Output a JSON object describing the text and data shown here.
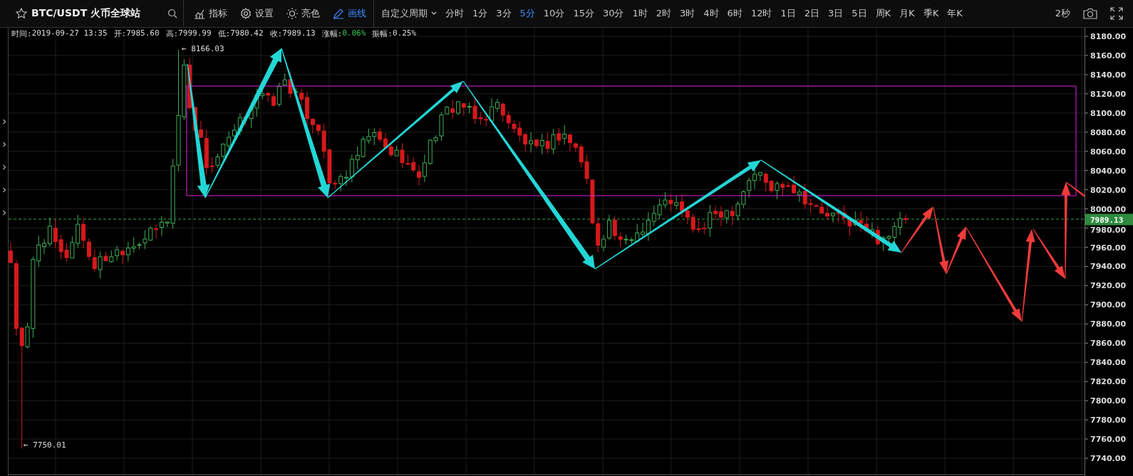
{
  "symbol": {
    "title": "BTC/USDT 火币全球站"
  },
  "tools": [
    {
      "label": "指标",
      "kind": "indicator",
      "selected": false
    },
    {
      "label": "设置",
      "kind": "settings",
      "selected": false
    },
    {
      "label": "亮色",
      "kind": "theme",
      "selected": false
    },
    {
      "label": "画线",
      "kind": "draw",
      "selected": true
    }
  ],
  "custom_period": {
    "label": "自定义周期"
  },
  "periods": [
    {
      "label": "分时",
      "selected": false
    },
    {
      "label": "1分",
      "selected": false
    },
    {
      "label": "3分",
      "selected": false
    },
    {
      "label": "5分",
      "selected": true
    },
    {
      "label": "10分",
      "selected": false
    },
    {
      "label": "15分",
      "selected": false
    },
    {
      "label": "30分",
      "selected": false
    },
    {
      "label": "1时",
      "selected": false
    },
    {
      "label": "2时",
      "selected": false
    },
    {
      "label": "3时",
      "selected": false
    },
    {
      "label": "4时",
      "selected": false
    },
    {
      "label": "6时",
      "selected": false
    },
    {
      "label": "12时",
      "selected": false
    },
    {
      "label": "1日",
      "selected": false
    },
    {
      "label": "2日",
      "selected": false
    },
    {
      "label": "3日",
      "selected": false
    },
    {
      "label": "5日",
      "selected": false
    },
    {
      "label": "周K",
      "selected": false
    },
    {
      "label": "月K",
      "selected": false
    },
    {
      "label": "季K",
      "selected": false
    },
    {
      "label": "年K",
      "selected": false
    }
  ],
  "refresh": {
    "label": "2秒"
  },
  "info": [
    {
      "label": "时间:",
      "value": "2019-09-27 13:35",
      "kind": "plain"
    },
    {
      "label": "开:",
      "value": "7985.60",
      "kind": "plain"
    },
    {
      "label": "高:",
      "value": "7999.99",
      "kind": "plain"
    },
    {
      "label": "低:",
      "value": "7980.42",
      "kind": "plain"
    },
    {
      "label": "收:",
      "value": "7989.13",
      "kind": "plain"
    },
    {
      "label": "涨幅:",
      "value": "0.06%",
      "kind": "up"
    },
    {
      "label": "振幅:",
      "value": "0.25%",
      "kind": "plain"
    }
  ],
  "chart": {
    "high_marker": "← 8166.03",
    "low_marker": "← 7750.01",
    "last_price": "7989.13",
    "y_axis": [
      "8180.00",
      "8160.00",
      "8140.00",
      "8120.00",
      "8100.00",
      "8080.00",
      "8060.00",
      "8040.00",
      "8020.00",
      "8000.00",
      "7980.00",
      "7960.00",
      "7940.00",
      "7920.00",
      "7900.00",
      "7880.00",
      "7860.00",
      "7840.00",
      "7820.00",
      "7800.00",
      "7780.00",
      "7760.00",
      "7740.00"
    ]
  }
}
